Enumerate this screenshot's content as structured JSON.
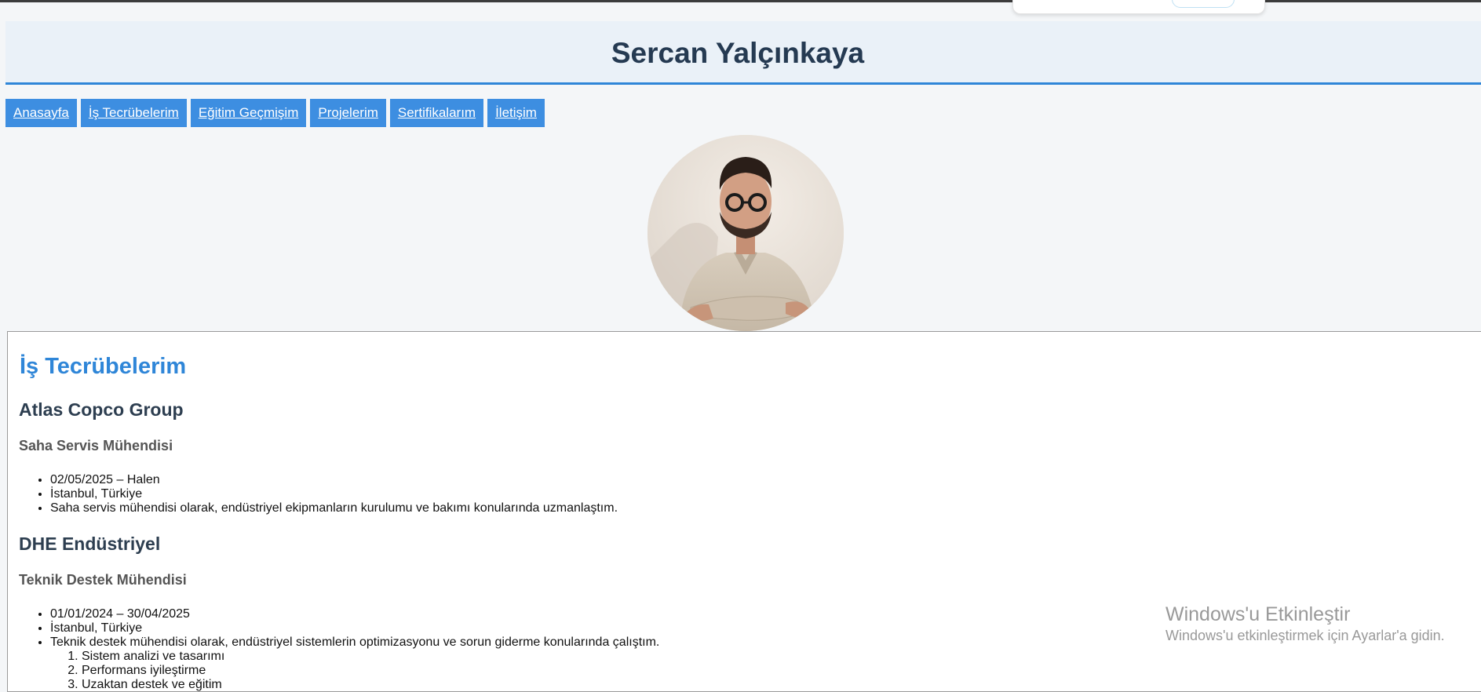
{
  "header": {
    "title": "Sercan Yalçınkaya"
  },
  "nav": {
    "items": [
      {
        "label": "Anasayfa"
      },
      {
        "label": "İş Tecrübelerim"
      },
      {
        "label": "Eğitim Geçmişim"
      },
      {
        "label": "Projelerim"
      },
      {
        "label": "Sertifikalarım"
      },
      {
        "label": "İletişim"
      }
    ]
  },
  "profile": {
    "photo_icon": "profile-photo"
  },
  "experience": {
    "title": "İş Tecrübelerim",
    "jobs": [
      {
        "company": "Atlas Copco Group",
        "role": "Saha Servis Mühendisi",
        "period": "02/05/2025 – Halen",
        "location": "İstanbul, Türkiye",
        "description": "Saha servis mühendisi olarak, endüstriyel ekipmanların kurulumu ve bakımı konularında uzmanlaştım."
      },
      {
        "company": "DHE Endüstriyel",
        "role": "Teknik Destek Mühendisi",
        "period": "01/01/2024 – 30/04/2025",
        "location": "İstanbul, Türkiye",
        "description": "Teknik destek mühendisi olarak, endüstriyel sistemlerin optimizasyonu ve sorun giderme konularında çalıştım.",
        "sub_items": [
          "Sistem analizi ve tasarımı",
          "Performans iyileştirme",
          "Uzaktan destek ve eğitim"
        ]
      }
    ]
  },
  "watermark": {
    "title": "Windows'u Etkinleştir",
    "subtitle": "Windows'u etkinleştirmek için Ayarlar'a gidin."
  },
  "colors": {
    "accent": "#3d8ee1",
    "heading_accent": "#2f86d8",
    "title_text": "#253a52",
    "header_bg": "#eaf1f8",
    "page_bg": "#f4f6f8"
  }
}
